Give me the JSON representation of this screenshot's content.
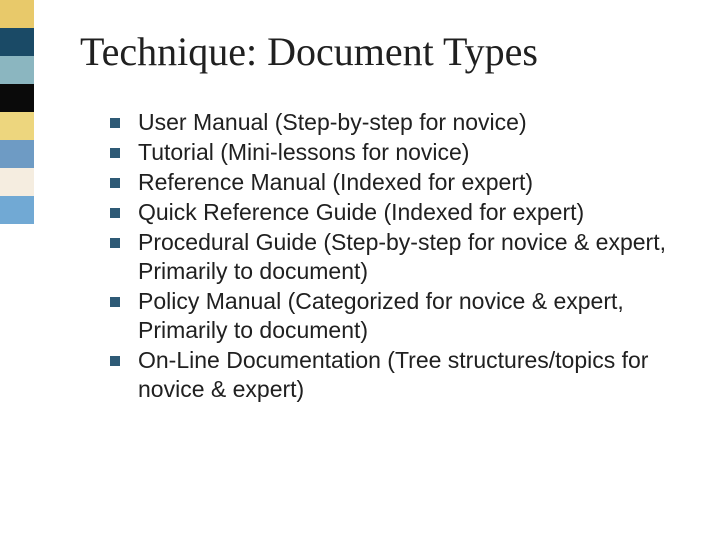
{
  "sidebar_colors": [
    "#e8c96a",
    "#1a4a66",
    "#8bb6c0",
    "#0a0a0a",
    "#edd67e",
    "#6e9bc4",
    "#f5ede0",
    "#71a9d4"
  ],
  "title": "Technique: Document Types",
  "bullets": [
    "User Manual (Step-by-step for novice)",
    "Tutorial (Mini-lessons for novice)",
    "Reference Manual (Indexed for expert)",
    "Quick Reference Guide (Indexed for expert)",
    "Procedural Guide (Step-by-step for novice & expert, Primarily to document)",
    "Policy Manual (Categorized for novice & expert, Primarily to document)",
    "On-Line Documentation (Tree structures/topics for novice & expert)"
  ]
}
